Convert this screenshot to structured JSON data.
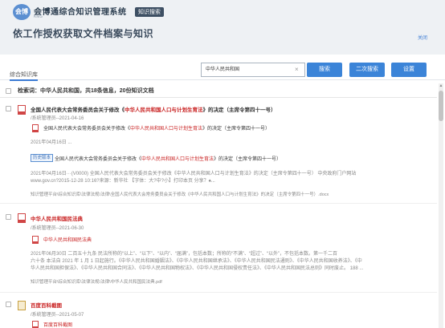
{
  "app": {
    "logo_text": "会博",
    "title": "会博通综合知识管理系统",
    "subtitle": "KMS",
    "tag": "知识搜索",
    "slogan": "依工作授权获取文件档案与知识",
    "close_label": "关闭"
  },
  "tabs": {
    "knowledge_base": "综合知识库"
  },
  "search": {
    "value": "中华人民共和国",
    "clear_symbol": "×",
    "search_label": "搜索",
    "second_search_label": "二次搜索",
    "settings_label": "设置"
  },
  "summary": "检索词：中华人民共和国，共18条信息，20份知识文档",
  "results": [
    {
      "title_prefix": "全国人民代表大会常务委员会关于修改《",
      "title_keyword": "中华人民共和国人口与计划生育法",
      "title_suffix": "》的决定（主席令第四十一号）",
      "meta": "/系统管理员--2021-04-16",
      "sub1_prefix": "全国人民代表大会常务委员会关于修改《",
      "sub1_keyword": "中华人民共和国人口与计划生育法",
      "sub1_suffix": "》的决定（主席令第四十一号）",
      "date_line": "2021年04月16日 ...",
      "history_label": "历史版本",
      "sub2_prefix": "全国人民代表大会常务委员会关于修改《",
      "sub2_keyword": "中华人民共和国人口与计划生育法",
      "sub2_suffix": "》的决定（主席令第四十一号）",
      "excerpt1": "2021年04月16日···(V0000) 全国人民代表大会常务委员会关于修改《中华人民共和国人口与计划生育法》的决定（主席令第四十一号） 中央政府门户网站",
      "excerpt2": "www.gov.cn?2015-12-28 10:16?来源：新华社 【字体：大?中?小】打印本页 分享？♠...",
      "path": "知识管理平台\\综合知识库\\法律法规\\法律\\全国人民代表大会常务委员会关于修改《中华人民共和国人口与计划生育法》的决定（主席令第四十一号）.docx"
    },
    {
      "title": "中华人民共和国民法典",
      "meta": "/系统管理员--2021-06-30",
      "sub1": "中华人民共和国民法典",
      "excerpt1": "2021年06月30日 二百五十九条 民法所称的“以上”、“以下”、“以内”、“届满”，包括本数；所称的“不满”、“超过”、“以外”，不包括本数。第一千二百",
      "excerpt2": "六十条 本法自 2021 年 1 月 1 日起施行。《中华人民共和国婚姻法》、《中华人民共和国继承法》、《中华人民共和国民法通则》、《中华人民共和国收养法》、《中",
      "excerpt3": "华人民共和国担保法》、《中华人民共和国合同法》、《中华人民共和国物权法》、《中华人民共和国侵权责任法》、《中华人民共和国民法总则》同时废止。 188 ...",
      "path": "知识管理平台\\综合知识库\\法律法规\\法律\\中华人民共和国民法典.pdf"
    },
    {
      "title": "百度百科截图",
      "meta": "/系统管理员--2021-05-07",
      "sub1": "百度百科截图"
    }
  ],
  "colors": {
    "accent": "#3b84d8",
    "keyword": "#c81e1e",
    "topbar": "#eef1f4"
  }
}
